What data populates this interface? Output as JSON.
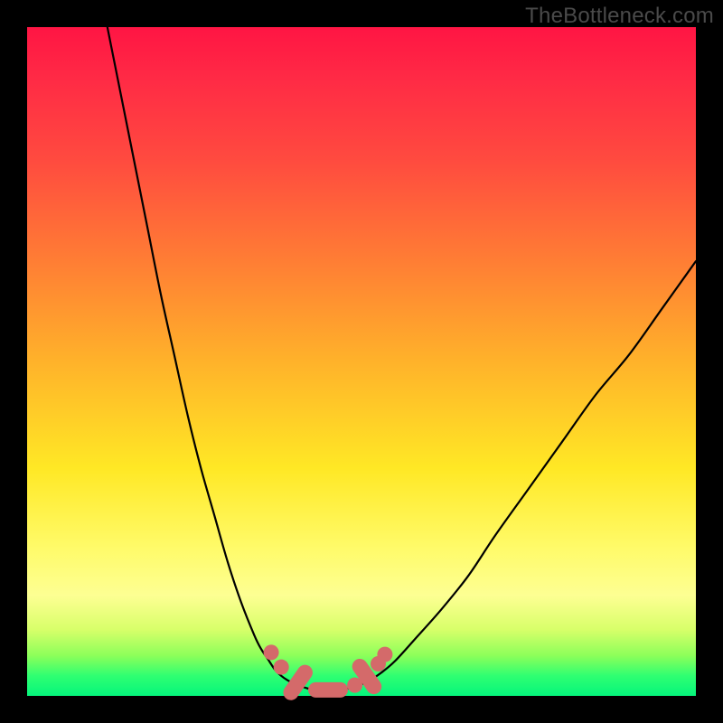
{
  "watermark": "TheBottleneck.com",
  "colors": {
    "frame": "#000000",
    "curve": "#000000",
    "marker": "#d46a6a",
    "gradient_stops": [
      "#ff1544",
      "#ff2b45",
      "#ff4b3f",
      "#ff7a35",
      "#ffb22a",
      "#ffe825",
      "#fffb6a",
      "#fdff93",
      "#d9ff6a",
      "#8cff5a",
      "#2fff71",
      "#05f57c"
    ]
  },
  "chart_data": {
    "type": "line",
    "title": "",
    "xlabel": "",
    "ylabel": "",
    "xlim": [
      0,
      100
    ],
    "ylim": [
      0,
      100
    ],
    "series": [
      {
        "name": "left-curve",
        "x": [
          12,
          14,
          16,
          18,
          20,
          22,
          24,
          26,
          28,
          30,
          32,
          34,
          35,
          36,
          37,
          38,
          39,
          40,
          41,
          42
        ],
        "y": [
          100,
          90,
          80,
          70,
          60,
          51,
          42,
          34,
          27,
          20,
          14,
          9,
          7,
          5.5,
          4,
          3,
          2.3,
          1.8,
          1.4,
          1.1
        ]
      },
      {
        "name": "valley-floor",
        "x": [
          42,
          43,
          44,
          45,
          46,
          47,
          48,
          49
        ],
        "y": [
          1.1,
          0.9,
          0.8,
          0.8,
          0.8,
          0.9,
          1.1,
          1.4
        ]
      },
      {
        "name": "right-curve",
        "x": [
          49,
          51,
          53,
          55,
          58,
          62,
          66,
          70,
          75,
          80,
          85,
          90,
          95,
          100
        ],
        "y": [
          1.4,
          2.2,
          3.5,
          5.2,
          8.5,
          13,
          18,
          24,
          31,
          38,
          45,
          51,
          58,
          65
        ]
      }
    ],
    "markers": [
      {
        "shape": "dot",
        "x": 36.5,
        "y": 6.5
      },
      {
        "shape": "dot",
        "x": 38.0,
        "y": 4.3
      },
      {
        "shape": "lozenge",
        "x": 40.5,
        "y": 2.0,
        "angle": -55
      },
      {
        "shape": "lozenge",
        "x": 45.0,
        "y": 0.9,
        "angle": 0
      },
      {
        "shape": "dot",
        "x": 49.0,
        "y": 1.6
      },
      {
        "shape": "lozenge",
        "x": 50.8,
        "y": 2.9,
        "angle": 55
      },
      {
        "shape": "dot",
        "x": 52.5,
        "y": 4.8
      },
      {
        "shape": "dot",
        "x": 53.5,
        "y": 6.2
      }
    ]
  }
}
